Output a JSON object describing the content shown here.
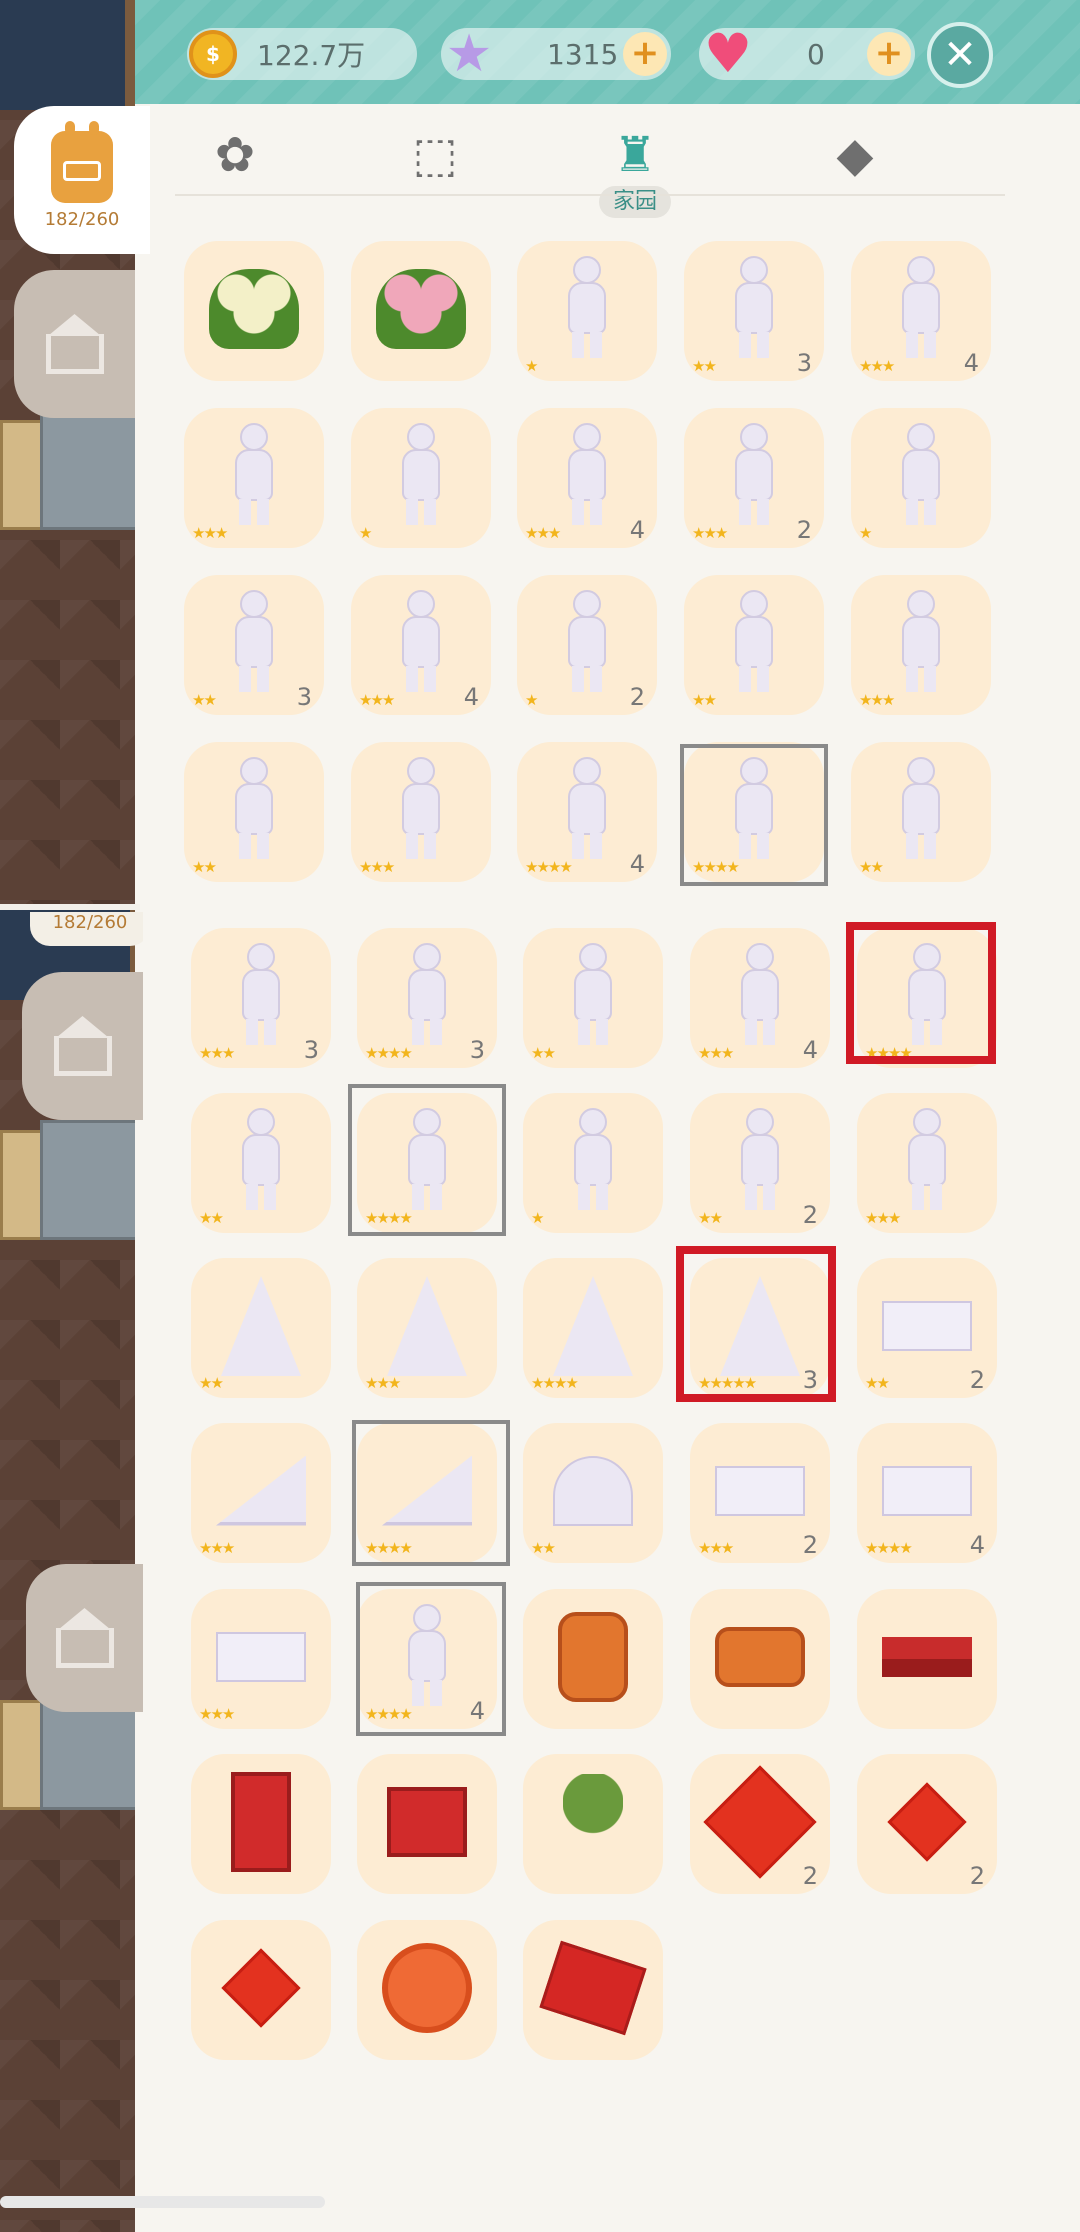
{
  "currencies": {
    "coins": "122.7万",
    "stars": "1315",
    "hearts": "0",
    "coin_symbol": "$",
    "star_symbol": "★",
    "heart_symbol": "♥",
    "plus": "+",
    "close": "✕"
  },
  "sidebar": {
    "backpack_count": "182/260",
    "backpack_count_repeat": "182/260"
  },
  "categories": [
    {
      "icon": "flower-pattern-icon",
      "glyph": "✿",
      "label": ""
    },
    {
      "icon": "box-toys-icon",
      "glyph": "⬚",
      "label": ""
    },
    {
      "icon": "armchair-icon",
      "glyph": "♜",
      "label": "家园"
    },
    {
      "icon": "shapes-icon",
      "glyph": "◆",
      "label": ""
    }
  ],
  "items": [
    {
      "kind": "flower",
      "color": "#f3f0c8",
      "stars": 0,
      "count": ""
    },
    {
      "kind": "flower",
      "color": "#f0a7ba",
      "stars": 0,
      "count": ""
    },
    {
      "kind": "statue",
      "stars": 1,
      "count": ""
    },
    {
      "kind": "statue",
      "stars": 2,
      "count": "3"
    },
    {
      "kind": "statue",
      "stars": 3,
      "count": "4"
    },
    {
      "kind": "statue",
      "stars": 3,
      "count": ""
    },
    {
      "kind": "statue",
      "stars": 1,
      "count": ""
    },
    {
      "kind": "statue",
      "stars": 3,
      "count": "4"
    },
    {
      "kind": "statue",
      "stars": 3,
      "count": "2"
    },
    {
      "kind": "statue",
      "stars": 1,
      "count": ""
    },
    {
      "kind": "statue",
      "stars": 2,
      "count": "3"
    },
    {
      "kind": "statue",
      "stars": 3,
      "count": "4"
    },
    {
      "kind": "statue",
      "stars": 1,
      "count": "2"
    },
    {
      "kind": "statue",
      "stars": 2,
      "count": ""
    },
    {
      "kind": "statue",
      "stars": 3,
      "count": ""
    },
    {
      "kind": "statue",
      "stars": 2,
      "count": ""
    },
    {
      "kind": "statue",
      "stars": 3,
      "count": ""
    },
    {
      "kind": "statue",
      "stars": 4,
      "count": "4"
    },
    {
      "kind": "statue",
      "stars": 4,
      "count": ""
    },
    {
      "kind": "statue",
      "stars": 2,
      "count": ""
    },
    {
      "kind": "statue",
      "stars": 3,
      "count": "3"
    },
    {
      "kind": "statue",
      "stars": 4,
      "count": "3"
    },
    {
      "kind": "statue",
      "stars": 2,
      "count": ""
    },
    {
      "kind": "statue",
      "stars": 3,
      "count": "4"
    },
    {
      "kind": "statue",
      "stars": 4,
      "count": ""
    },
    {
      "kind": "statue",
      "stars": 2,
      "count": ""
    },
    {
      "kind": "statue",
      "stars": 4,
      "count": ""
    },
    {
      "kind": "statue",
      "stars": 1,
      "count": ""
    },
    {
      "kind": "statue",
      "stars": 2,
      "count": "2"
    },
    {
      "kind": "statue",
      "stars": 3,
      "count": ""
    },
    {
      "kind": "tree",
      "stars": 2,
      "count": ""
    },
    {
      "kind": "tree",
      "stars": 3,
      "count": ""
    },
    {
      "kind": "tree",
      "stars": 4,
      "count": ""
    },
    {
      "kind": "tree",
      "stars": 5,
      "count": "3"
    },
    {
      "kind": "block",
      "stars": 2,
      "count": "2"
    },
    {
      "kind": "wedge",
      "stars": 3,
      "count": ""
    },
    {
      "kind": "wedge",
      "stars": 4,
      "count": ""
    },
    {
      "kind": "arch",
      "stars": 2,
      "count": ""
    },
    {
      "kind": "block",
      "stars": 3,
      "count": "2"
    },
    {
      "kind": "block",
      "stars": 4,
      "count": "4"
    },
    {
      "kind": "block",
      "stars": 3,
      "count": ""
    },
    {
      "kind": "statue",
      "stars": 4,
      "count": "4"
    },
    {
      "kind": "chair",
      "stars": 0,
      "count": ""
    },
    {
      "kind": "sofa",
      "stars": 0,
      "count": ""
    },
    {
      "kind": "table",
      "stars": 0,
      "count": ""
    },
    {
      "kind": "cabinet",
      "stars": 0,
      "count": ""
    },
    {
      "kind": "dresser",
      "stars": 0,
      "count": ""
    },
    {
      "kind": "plant",
      "stars": 0,
      "count": ""
    },
    {
      "kind": "diamond",
      "stars": 0,
      "count": "2"
    },
    {
      "kind": "diamond-small",
      "stars": 0,
      "count": "2"
    },
    {
      "kind": "diamond-small",
      "stars": 0,
      "count": ""
    },
    {
      "kind": "round",
      "stars": 0,
      "count": ""
    },
    {
      "kind": "rug",
      "stars": 0,
      "count": ""
    }
  ],
  "colors": {
    "accent": "#6fc2b8",
    "tile": "#fdecd3",
    "star": "#f2b51d",
    "highlight_red": "#d01a25",
    "highlight_gray": "#8a8a8a"
  }
}
